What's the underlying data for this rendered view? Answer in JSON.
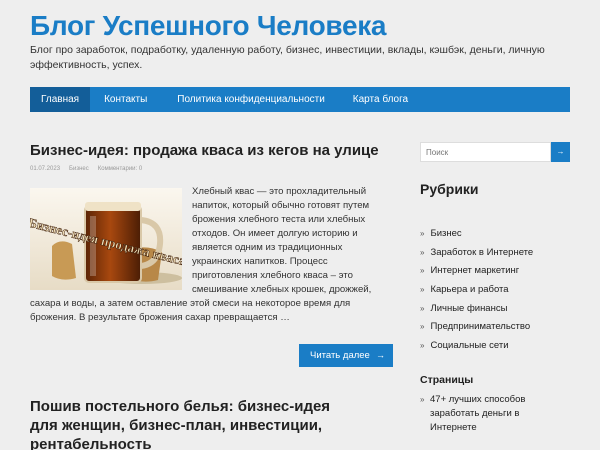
{
  "site": {
    "title": "Блог Успешного Человека",
    "description": "Блог про заработок, подработку, удаленную работу, бизнес, инвестиции, вклады, кэшбэк, деньги, личную эффективность, успех."
  },
  "nav": {
    "items": [
      {
        "label": "Главная",
        "active": true
      },
      {
        "label": "Контакты"
      },
      {
        "label": "Политика конфиденциальности"
      },
      {
        "label": "Карта блога"
      }
    ]
  },
  "posts": [
    {
      "title": "Бизнес-идея: продажа кваса из кегов на улице",
      "date": "01.07.2023",
      "category": "Бизнес",
      "comments": "Комментарии: 0",
      "thumb_text": "Бизнес-идея продажа кваса",
      "excerpt": "Хлебный квас — это прохладительный напиток, который обычно готовят путем брожения хлебного теста или хлебных отходов. Он имеет долгую историю и является одним из традиционных украинских напитков. Процесс приготовления хлебного кваса – это смешивание хлебных крошек, дрожжей, сахара и воды, а затем оставление этой смеси на некоторое время для брожения. В результате брожения сахар превращается …",
      "read_more": "Читать далее",
      "read_more_icon": "arrow-right-icon"
    },
    {
      "title": "Пошив постельного белья: бизнес-идея для женщин, бизнес-план, инвестиции, рентабельность"
    }
  ],
  "sidebar": {
    "search_placeholder": "Поиск",
    "search_icon": "arrow-right-icon",
    "rubriki_title": "Рубрики",
    "categories": [
      "Бизнес",
      "Заработок в Интернете",
      "Интернет маркетинг",
      "Карьера и работа",
      "Личные финансы",
      "Предпринимательство",
      "Социальные сети"
    ],
    "pages_title": "Страницы",
    "pages": [
      "47+ лучших способов заработать деньги в Интернете"
    ],
    "bullet": "»"
  },
  "colors": {
    "accent": "#1a7dc6",
    "accent_dark": "#135e99",
    "background": "#eeeeee"
  }
}
